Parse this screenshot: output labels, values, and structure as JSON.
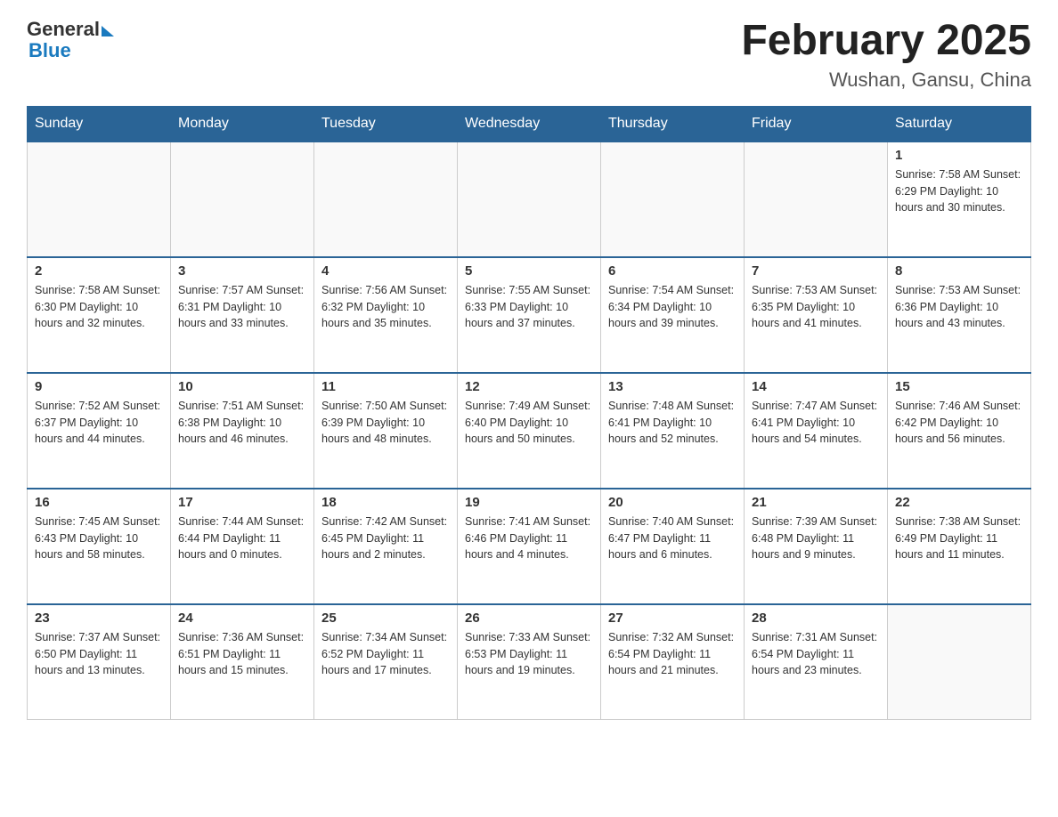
{
  "header": {
    "logo_general": "General",
    "logo_blue": "Blue",
    "month_title": "February 2025",
    "location": "Wushan, Gansu, China"
  },
  "days_of_week": [
    "Sunday",
    "Monday",
    "Tuesday",
    "Wednesday",
    "Thursday",
    "Friday",
    "Saturday"
  ],
  "weeks": [
    [
      {
        "day": "",
        "info": ""
      },
      {
        "day": "",
        "info": ""
      },
      {
        "day": "",
        "info": ""
      },
      {
        "day": "",
        "info": ""
      },
      {
        "day": "",
        "info": ""
      },
      {
        "day": "",
        "info": ""
      },
      {
        "day": "1",
        "info": "Sunrise: 7:58 AM\nSunset: 6:29 PM\nDaylight: 10 hours and 30 minutes."
      }
    ],
    [
      {
        "day": "2",
        "info": "Sunrise: 7:58 AM\nSunset: 6:30 PM\nDaylight: 10 hours and 32 minutes."
      },
      {
        "day": "3",
        "info": "Sunrise: 7:57 AM\nSunset: 6:31 PM\nDaylight: 10 hours and 33 minutes."
      },
      {
        "day": "4",
        "info": "Sunrise: 7:56 AM\nSunset: 6:32 PM\nDaylight: 10 hours and 35 minutes."
      },
      {
        "day": "5",
        "info": "Sunrise: 7:55 AM\nSunset: 6:33 PM\nDaylight: 10 hours and 37 minutes."
      },
      {
        "day": "6",
        "info": "Sunrise: 7:54 AM\nSunset: 6:34 PM\nDaylight: 10 hours and 39 minutes."
      },
      {
        "day": "7",
        "info": "Sunrise: 7:53 AM\nSunset: 6:35 PM\nDaylight: 10 hours and 41 minutes."
      },
      {
        "day": "8",
        "info": "Sunrise: 7:53 AM\nSunset: 6:36 PM\nDaylight: 10 hours and 43 minutes."
      }
    ],
    [
      {
        "day": "9",
        "info": "Sunrise: 7:52 AM\nSunset: 6:37 PM\nDaylight: 10 hours and 44 minutes."
      },
      {
        "day": "10",
        "info": "Sunrise: 7:51 AM\nSunset: 6:38 PM\nDaylight: 10 hours and 46 minutes."
      },
      {
        "day": "11",
        "info": "Sunrise: 7:50 AM\nSunset: 6:39 PM\nDaylight: 10 hours and 48 minutes."
      },
      {
        "day": "12",
        "info": "Sunrise: 7:49 AM\nSunset: 6:40 PM\nDaylight: 10 hours and 50 minutes."
      },
      {
        "day": "13",
        "info": "Sunrise: 7:48 AM\nSunset: 6:41 PM\nDaylight: 10 hours and 52 minutes."
      },
      {
        "day": "14",
        "info": "Sunrise: 7:47 AM\nSunset: 6:41 PM\nDaylight: 10 hours and 54 minutes."
      },
      {
        "day": "15",
        "info": "Sunrise: 7:46 AM\nSunset: 6:42 PM\nDaylight: 10 hours and 56 minutes."
      }
    ],
    [
      {
        "day": "16",
        "info": "Sunrise: 7:45 AM\nSunset: 6:43 PM\nDaylight: 10 hours and 58 minutes."
      },
      {
        "day": "17",
        "info": "Sunrise: 7:44 AM\nSunset: 6:44 PM\nDaylight: 11 hours and 0 minutes."
      },
      {
        "day": "18",
        "info": "Sunrise: 7:42 AM\nSunset: 6:45 PM\nDaylight: 11 hours and 2 minutes."
      },
      {
        "day": "19",
        "info": "Sunrise: 7:41 AM\nSunset: 6:46 PM\nDaylight: 11 hours and 4 minutes."
      },
      {
        "day": "20",
        "info": "Sunrise: 7:40 AM\nSunset: 6:47 PM\nDaylight: 11 hours and 6 minutes."
      },
      {
        "day": "21",
        "info": "Sunrise: 7:39 AM\nSunset: 6:48 PM\nDaylight: 11 hours and 9 minutes."
      },
      {
        "day": "22",
        "info": "Sunrise: 7:38 AM\nSunset: 6:49 PM\nDaylight: 11 hours and 11 minutes."
      }
    ],
    [
      {
        "day": "23",
        "info": "Sunrise: 7:37 AM\nSunset: 6:50 PM\nDaylight: 11 hours and 13 minutes."
      },
      {
        "day": "24",
        "info": "Sunrise: 7:36 AM\nSunset: 6:51 PM\nDaylight: 11 hours and 15 minutes."
      },
      {
        "day": "25",
        "info": "Sunrise: 7:34 AM\nSunset: 6:52 PM\nDaylight: 11 hours and 17 minutes."
      },
      {
        "day": "26",
        "info": "Sunrise: 7:33 AM\nSunset: 6:53 PM\nDaylight: 11 hours and 19 minutes."
      },
      {
        "day": "27",
        "info": "Sunrise: 7:32 AM\nSunset: 6:54 PM\nDaylight: 11 hours and 21 minutes."
      },
      {
        "day": "28",
        "info": "Sunrise: 7:31 AM\nSunset: 6:54 PM\nDaylight: 11 hours and 23 minutes."
      },
      {
        "day": "",
        "info": ""
      }
    ]
  ]
}
